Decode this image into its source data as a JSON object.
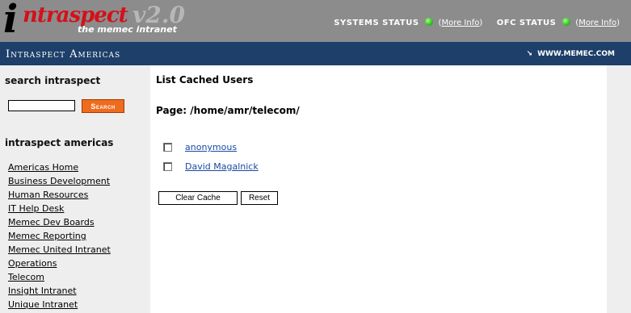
{
  "header": {
    "logo": {
      "letter": "i",
      "word": "ntraspect",
      "version": "v2.0",
      "tagline": "the memec intranet"
    },
    "systems_status": {
      "label": "SYSTEMS STATUS",
      "link": "More Info",
      "color": "#2ecc2a"
    },
    "ofc_status": {
      "label": "OFC STATUS",
      "link": "More Info",
      "color": "#2ecc2a"
    }
  },
  "navbar": {
    "title": "Intraspect Americas",
    "link_arrow": "↘",
    "link": "WWW.MEMEC.COM"
  },
  "sidebar": {
    "search_heading": "search intraspect",
    "search_value": "",
    "search_button": "Search",
    "section_heading": "intraspect americas",
    "links": [
      "Americas Home",
      "Business Development",
      "Human Resources",
      "IT Help Desk",
      "Memec Dev Boards",
      "Memec Reporting",
      "Memec United Intranet",
      "Operations",
      "Telecom",
      "Insight Intranet",
      "Unique Intranet"
    ]
  },
  "main": {
    "heading": "List Cached Users",
    "page_path": "Page: /home/amr/telecom/",
    "users": [
      {
        "name": "anonymous",
        "checked": false
      },
      {
        "name": "David Magalnick",
        "checked": false
      }
    ],
    "clear_cache_button": "Clear Cache",
    "reset_button": "Reset"
  },
  "colors": {
    "header_bg": "#8c8c8c",
    "navbar_bg": "#1d3f6a",
    "sidebar_bg": "#eeeeee",
    "search_button_bg": "#ef6b1d",
    "logo_red": "#d4101a",
    "link": "#1a4aa0"
  }
}
